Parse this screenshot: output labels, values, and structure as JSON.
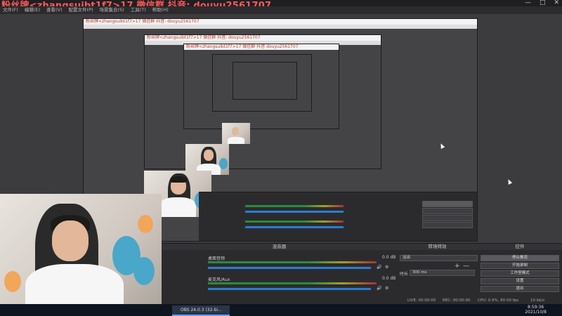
{
  "window": {
    "title": "粉丝牌<zhangsuibt1f7>17 微信群  抖音: douyu2561707",
    "controls": {
      "minimize": "—",
      "maximize": "□",
      "close": "✕"
    }
  },
  "menubar": [
    "文件(F)",
    "编辑(E)",
    "查看(V)",
    "配置文件(P)",
    "场景集合(S)",
    "工具(T)",
    "帮助(H)"
  ],
  "nested_titles": [
    "粉丝牌<zhangsuibt1f7>17 微信群  抖音: douyu2561707",
    "粉丝牌<zhangsuibt1f7>17 微信群 抖音: douyu2561707",
    "粉丝牌<zhangsuibt1f7>17 微信群 抖音 douyu2561707"
  ],
  "mixer": {
    "title": "混音器",
    "channels": [
      {
        "name": "桌面音频",
        "db": "0.0 dB"
      },
      {
        "name": "麦克风/Aux",
        "db": "0.0 dB"
      }
    ]
  },
  "transitions": {
    "title": "转场特效",
    "type": "淡出",
    "duration_label": "时长",
    "duration_value": "300 ms",
    "add": "+",
    "remove": "—"
  },
  "controls": {
    "title": "控件",
    "buttons": [
      "停止推流",
      "开始录制",
      "工作室模式",
      "设置",
      "退出"
    ]
  },
  "status": {
    "live": "LIVE: 00:00:00",
    "rec": "REC: 00:00:00",
    "cpu": "CPU: 0.9%, 60.00 fps",
    "kbps": "10 kb/s"
  },
  "taskbar": {
    "app_label": "OBS 24.0.3 (32-bi...",
    "time": "8:59:36",
    "date": "2021/10/8"
  },
  "colors": {
    "accent": "#2e7bd1",
    "title_text": "#ff5a5a",
    "panel": "#2b2b2e"
  }
}
